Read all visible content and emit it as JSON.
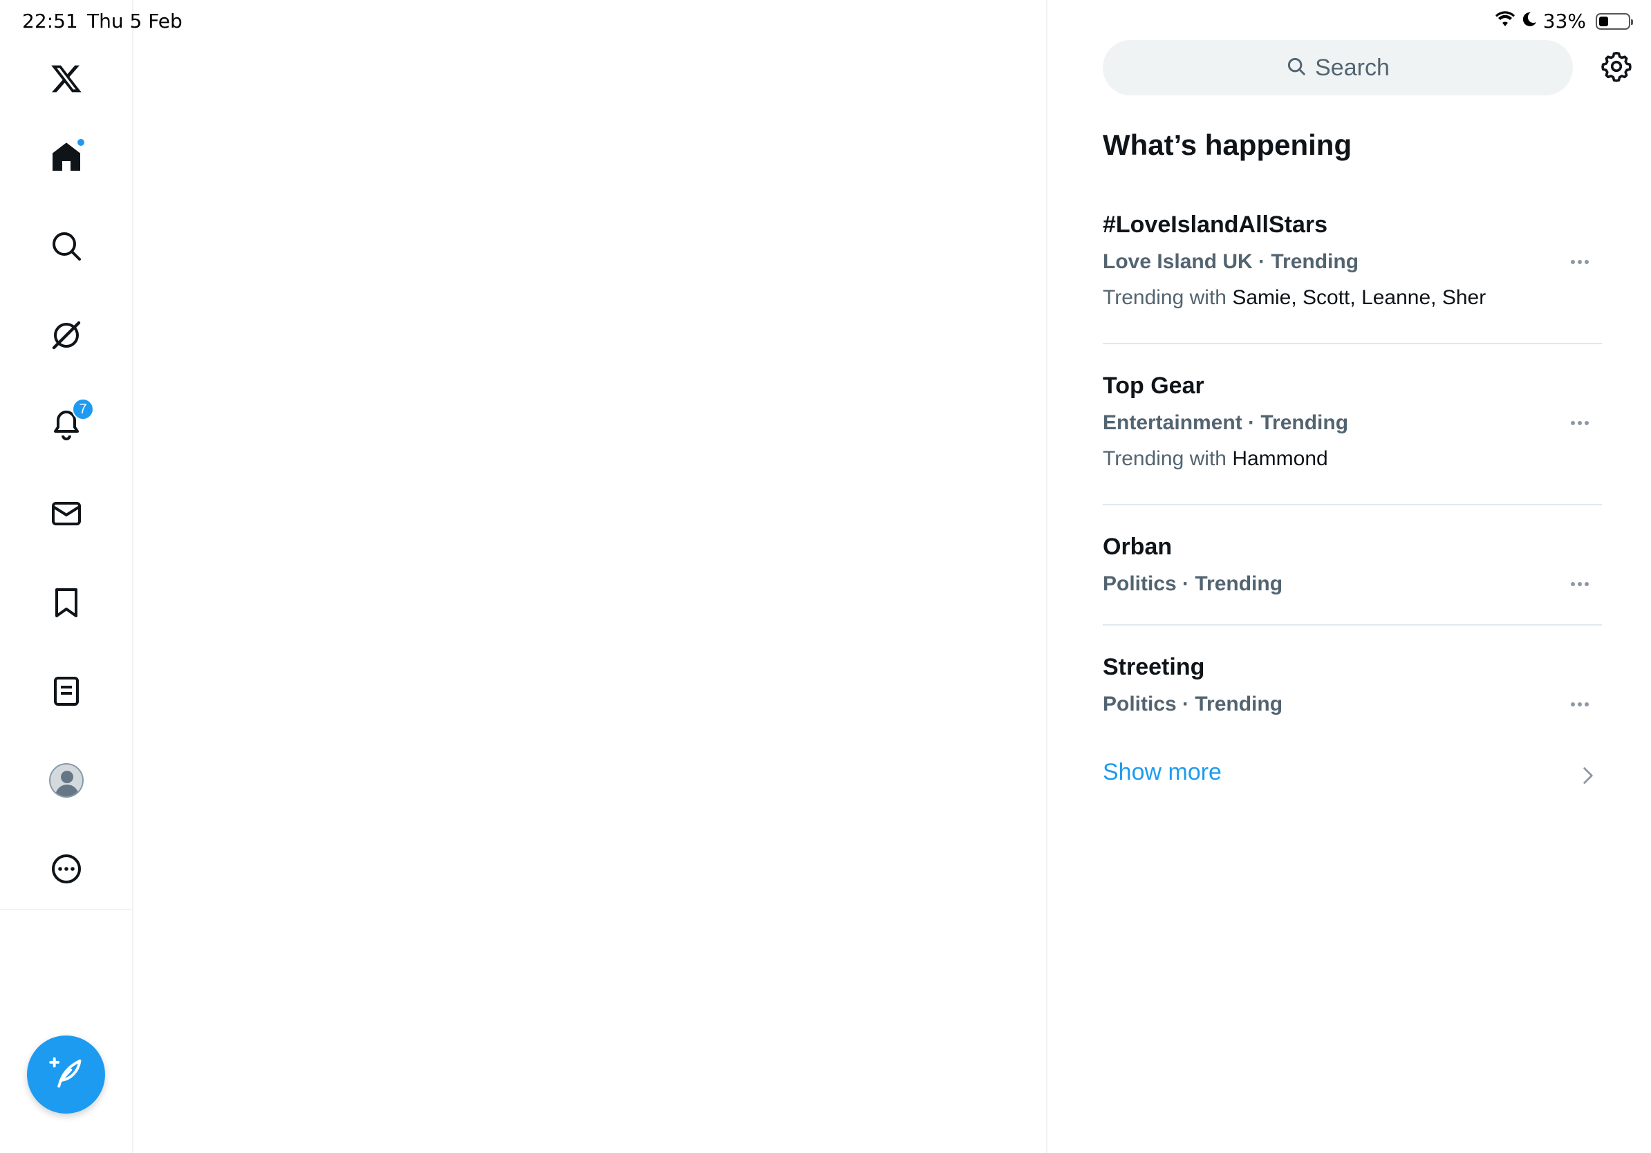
{
  "status_bar": {
    "time": "22:51",
    "date": "Thu 5 Feb",
    "battery": "33%",
    "battery_level": 0.33
  },
  "nav": {
    "items": [
      {
        "name": "x-logo-icon"
      },
      {
        "name": "home-icon",
        "badge": "dot"
      },
      {
        "name": "search-icon"
      },
      {
        "name": "grok-icon"
      },
      {
        "name": "notifications-icon",
        "badge_count": "7"
      },
      {
        "name": "messages-icon"
      },
      {
        "name": "bookmarks-icon"
      },
      {
        "name": "lists-icon"
      },
      {
        "name": "profile-avatar"
      },
      {
        "name": "more-icon"
      }
    ],
    "compose": "compose-icon"
  },
  "sidebar": {
    "search_placeholder": "Search",
    "section_title": "What’s happening",
    "trends": [
      {
        "name": "#LoveIslandAllStars",
        "meta": "Love Island UK · Trending",
        "with_prefix": "Trending with",
        "with_names": "Samie, Scott, Leanne, Sher"
      },
      {
        "name": "Top Gear",
        "meta": "Entertainment · Trending",
        "with_prefix": "Trending with",
        "with_names": "Hammond"
      },
      {
        "name": "Orban",
        "meta": "Politics · Trending"
      },
      {
        "name": "Streeting",
        "meta": "Politics · Trending"
      }
    ],
    "show_more": "Show more"
  },
  "colors": {
    "accent": "#1d9bf0",
    "text_primary": "#0f1419",
    "text_secondary": "#536471",
    "border": "#eff3f4"
  }
}
